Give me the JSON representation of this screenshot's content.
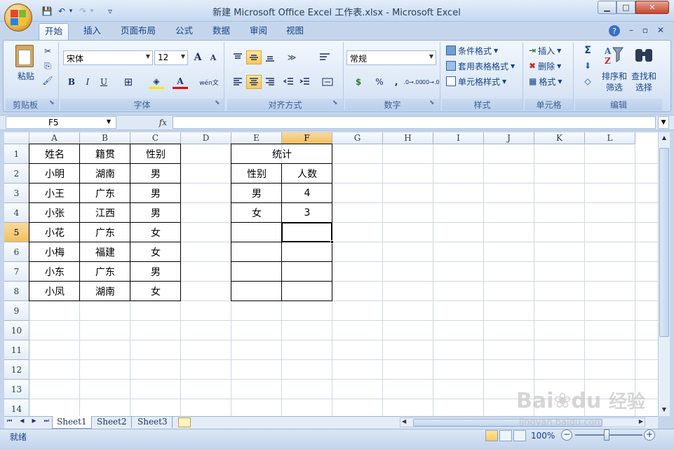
{
  "window": {
    "title": "新建 Microsoft Office Excel 工作表.xlsx - Microsoft Excel",
    "minimize_glyph": "▁",
    "maximize_glyph": "□",
    "close_glyph": "✕"
  },
  "qat": {
    "save": "💾",
    "undo": "↶",
    "undo_dd": "▾",
    "redo": "↷",
    "redo_dd": "▾",
    "customize": "▿"
  },
  "ribbon_tabs": [
    "开始",
    "插入",
    "页面布局",
    "公式",
    "数据",
    "审阅",
    "视图"
  ],
  "ribbon_right": {
    "help": "?",
    "min": "–",
    "restore": "▫",
    "close": "✕"
  },
  "clipboard": {
    "paste_label": "粘贴",
    "group_label": "剪贴板",
    "cut": "✂",
    "copy": "⎘",
    "format_painter": "🖌",
    "launcher": "⬊"
  },
  "font": {
    "name": "宋体",
    "size": "12",
    "grow": "A",
    "shrink": "A",
    "bold": "B",
    "italic": "I",
    "underline": "U",
    "border": "⊞",
    "fill": "◈",
    "fontcolor": "A",
    "wen": "wén文",
    "group_label": "字体",
    "launcher": "⬊"
  },
  "alignment": {
    "group_label": "对齐方式",
    "launcher": "⬊",
    "orient": "≫"
  },
  "number": {
    "format": "常规",
    "currency": "$",
    "percent": "%",
    "comma": ",",
    "inc": ".0→.00",
    "dec": ".00→.0",
    "group_label": "数字",
    "launcher": "⬊"
  },
  "styles": {
    "conditional": "条件格式",
    "table": "套用表格格式",
    "cell": "单元格样式",
    "group_label": "样式"
  },
  "cells": {
    "insert": "插入",
    "delete": "删除",
    "format": "格式",
    "group_label": "单元格"
  },
  "editing": {
    "sum": "Σ",
    "fill": "⬇",
    "clear": "◇",
    "sort": "排序和",
    "sort2": "筛选",
    "find": "查找和",
    "find2": "选择",
    "group_label": "编辑"
  },
  "formula_bar": {
    "name_box": "F5",
    "fx": "fx",
    "formula": ""
  },
  "columns": [
    "A",
    "B",
    "C",
    "D",
    "E",
    "F",
    "G",
    "H",
    "I",
    "J",
    "K",
    "L"
  ],
  "rows": [
    "1",
    "2",
    "3",
    "4",
    "5",
    "6",
    "7",
    "8",
    "9",
    "10",
    "11",
    "12",
    "13",
    "14"
  ],
  "cells_data": {
    "A1": "姓名",
    "B1": "籍贯",
    "C1": "性别",
    "A2": "小明",
    "B2": "湖南",
    "C2": "男",
    "A3": "小王",
    "B3": "广东",
    "C3": "男",
    "A4": "小张",
    "B4": "江西",
    "C4": "男",
    "A5": "小花",
    "B5": "广东",
    "C5": "女",
    "A6": "小梅",
    "B6": "福建",
    "C6": "女",
    "A7": "小东",
    "B7": "广东",
    "C7": "男",
    "A8": "小凤",
    "B8": "湖南",
    "C8": "女",
    "E1": "统计",
    "E2": "性别",
    "F2": "人数",
    "E3": "男",
    "F3": "4",
    "E4": "女",
    "F4": "3"
  },
  "sheets": [
    "Sheet1",
    "Sheet2",
    "Sheet3"
  ],
  "sheet_nav": [
    "⏮",
    "◀",
    "▶",
    "⏭"
  ],
  "status": {
    "ready": "就绪",
    "zoom": "100%",
    "zoom_out": "−",
    "zoom_in": "+"
  },
  "watermark": {
    "brand": "Bai",
    "brand2": "du",
    "cn": "经验",
    "url": "jingyan.baidu.com"
  }
}
